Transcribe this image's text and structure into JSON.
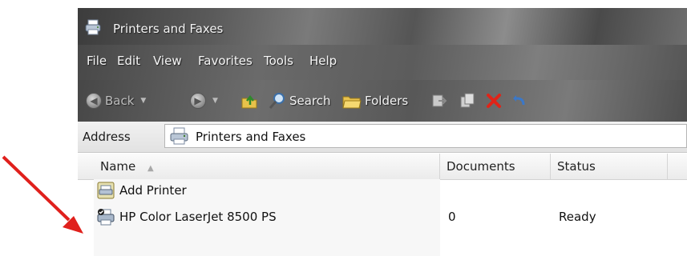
{
  "window": {
    "title": "Printers and Faxes"
  },
  "menu": [
    "File",
    "Edit",
    "View",
    "Favorites",
    "Tools",
    "Help"
  ],
  "toolbar": {
    "back_label": "Back",
    "search_label": "Search",
    "folders_label": "Folders"
  },
  "address": {
    "label": "Address",
    "value": "Printers and Faxes"
  },
  "columns": {
    "name": "Name",
    "documents": "Documents",
    "status": "Status"
  },
  "rows": [
    {
      "name": "Add Printer",
      "documents": "",
      "status": ""
    },
    {
      "name": "HP Color LaserJet 8500 PS",
      "documents": "0",
      "status": "Ready"
    }
  ],
  "colors": {
    "annotation_arrow": "#e0201c"
  }
}
